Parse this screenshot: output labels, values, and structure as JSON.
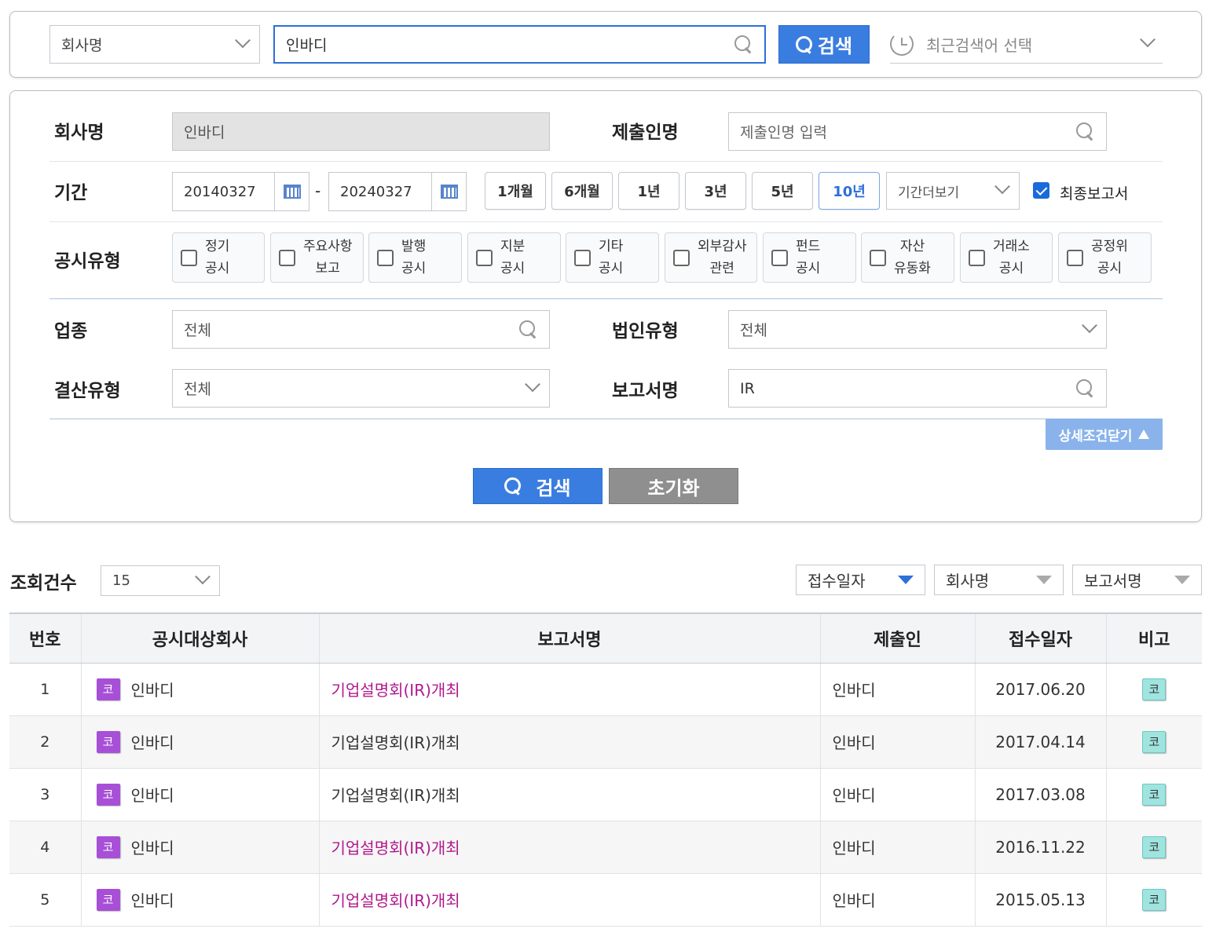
{
  "top_search": {
    "category": "회사명",
    "query": "인바디",
    "search_button": "검색",
    "recent_placeholder": "최근검색어 선택"
  },
  "filters": {
    "company_label": "회사명",
    "company_value": "인바디",
    "submitter_label": "제출인명",
    "submitter_placeholder": "제출인명 입력",
    "period_label": "기간",
    "date_from": "20140327",
    "date_to": "20240327",
    "date_sep": "-",
    "period_buttons": [
      "1개월",
      "6개월",
      "1년",
      "3년",
      "5년",
      "10년"
    ],
    "period_active": "10년",
    "period_more": "기간더보기",
    "final_report_label": "최종보고서",
    "final_report_checked": true,
    "pub_type_label": "공시유형",
    "pub_types": [
      {
        "l1": "정기",
        "l2": "공시"
      },
      {
        "l1": "주요사항",
        "l2": "보고"
      },
      {
        "l1": "발행",
        "l2": "공시"
      },
      {
        "l1": "지분",
        "l2": "공시"
      },
      {
        "l1": "기타",
        "l2": "공시"
      },
      {
        "l1": "외부감사",
        "l2": "관련"
      },
      {
        "l1": "펀드",
        "l2": "공시"
      },
      {
        "l1": "자산",
        "l2": "유동화"
      },
      {
        "l1": "거래소",
        "l2": "공시"
      },
      {
        "l1": "공정위",
        "l2": "공시"
      }
    ],
    "industry_label": "업종",
    "industry_value": "전체",
    "corp_type_label": "법인유형",
    "corp_type_value": "전체",
    "settle_label": "결산유형",
    "settle_value": "전체",
    "report_label": "보고서명",
    "report_value": "IR",
    "detail_toggle": "상세조건닫기",
    "search_button": "검색",
    "reset_button": "초기화"
  },
  "results": {
    "count_label": "조회건수",
    "count_value": "15",
    "sort": [
      "접수일자",
      "회사명",
      "보고서명"
    ],
    "columns": [
      "번호",
      "공시대상회사",
      "보고서명",
      "제출인",
      "접수일자",
      "비고"
    ],
    "market_badge": "코",
    "rows": [
      {
        "no": "1",
        "company": "인바디",
        "report": "기업설명회(IR)개최",
        "submitter": "인바디",
        "date": "2017.06.20",
        "note": "코"
      },
      {
        "no": "2",
        "company": "인바디",
        "report": "기업설명회(IR)개최",
        "submitter": "인바디",
        "date": "2017.04.14",
        "note": "코"
      },
      {
        "no": "3",
        "company": "인바디",
        "report": "기업설명회(IR)개최",
        "submitter": "인바디",
        "date": "2017.03.08",
        "note": "코"
      },
      {
        "no": "4",
        "company": "인바디",
        "report": "기업설명회(IR)개최",
        "submitter": "인바디",
        "date": "2016.11.22",
        "note": "코"
      },
      {
        "no": "5",
        "company": "인바디",
        "report": "기업설명회(IR)개최",
        "submitter": "인바디",
        "date": "2015.05.13",
        "note": "코"
      }
    ]
  },
  "colors": {
    "accent": "#3a7de0",
    "report_link": "#b0198c",
    "market_badge": "#a74fd6",
    "note_badge": "#9fe4df"
  }
}
